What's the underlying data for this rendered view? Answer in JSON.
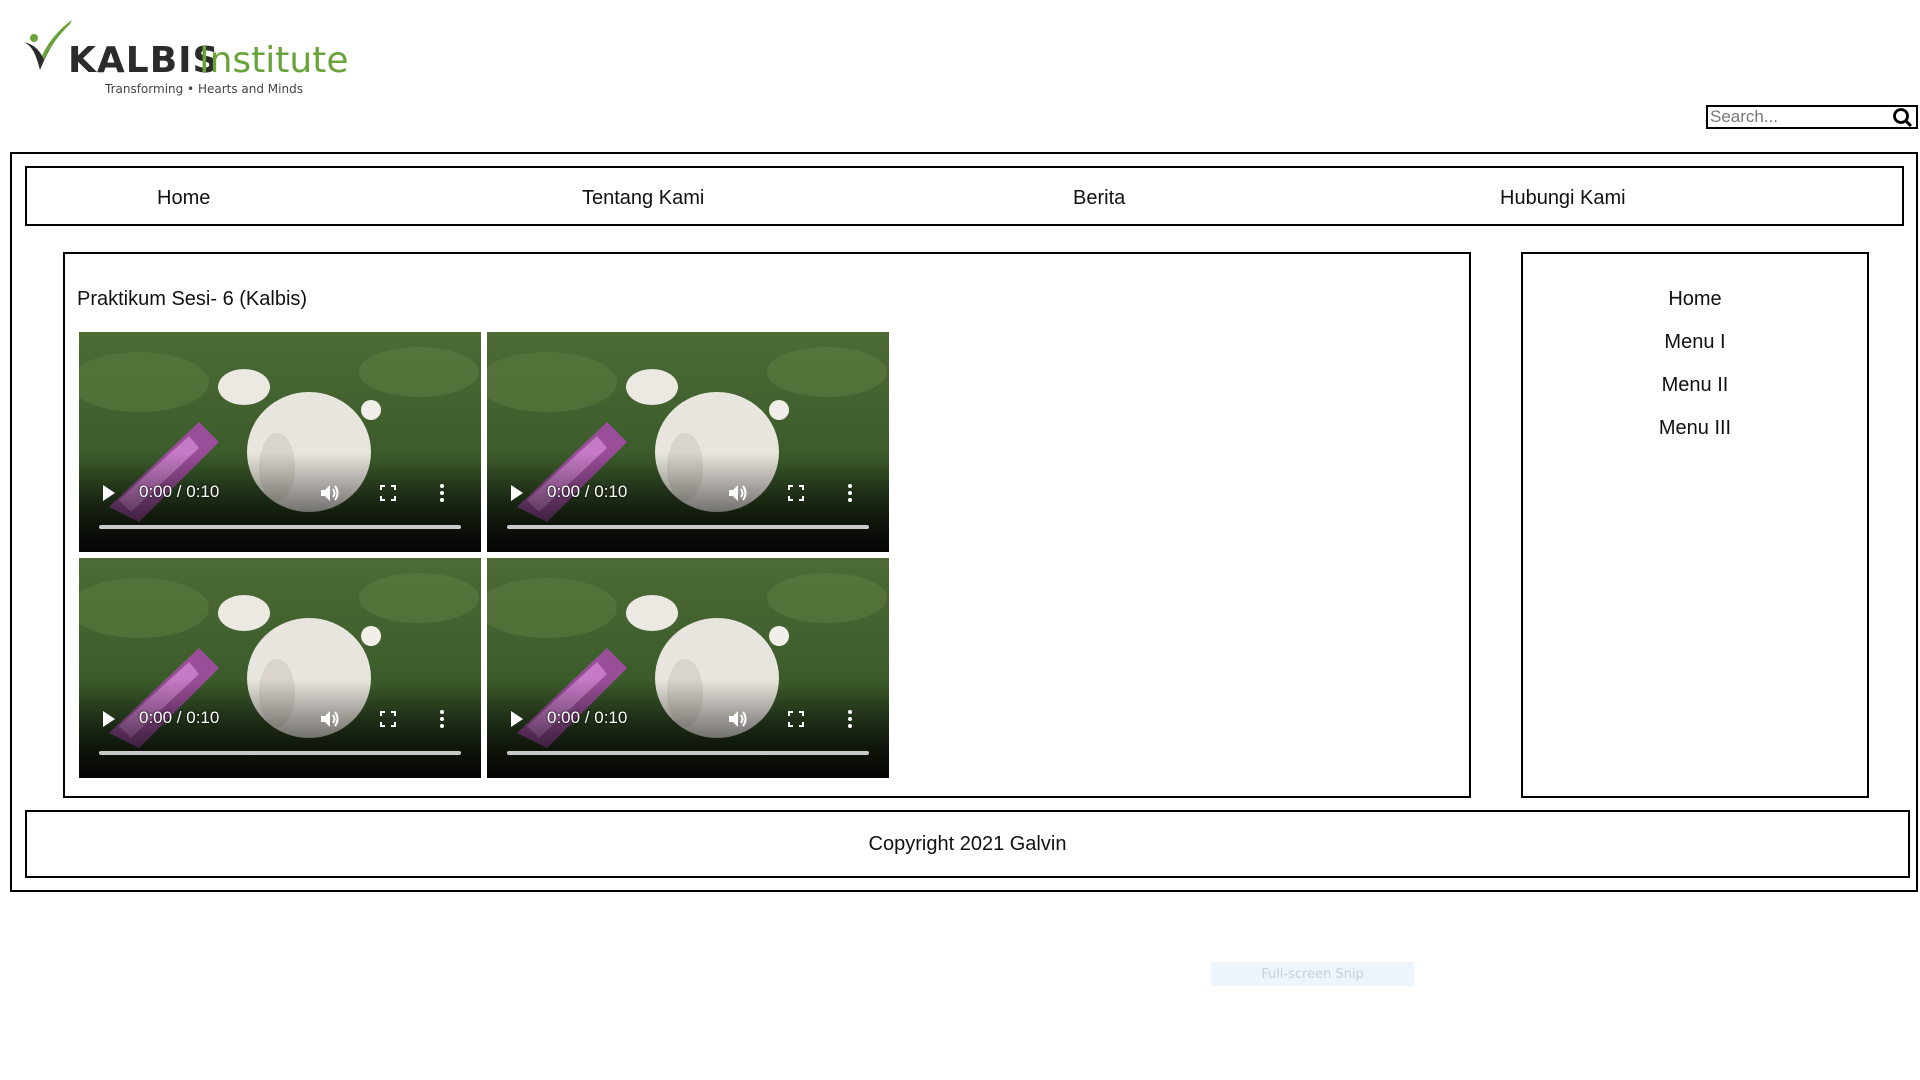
{
  "logo": {
    "brand": "KALBIS",
    "brand_suffix": "Institute",
    "tagline": "Transforming • Hearts and Minds"
  },
  "search": {
    "placeholder": "Search..."
  },
  "nav": {
    "items": [
      {
        "label": "Home"
      },
      {
        "label": "Tentang Kami"
      },
      {
        "label": "Berita"
      },
      {
        "label": "Hubungi Kami"
      }
    ]
  },
  "main": {
    "title": "Praktikum Sesi- 6 (Kalbis)",
    "videos": [
      {
        "time": "0:00 / 0:10"
      },
      {
        "time": "0:00 / 0:10"
      },
      {
        "time": "0:00 / 0:10"
      },
      {
        "time": "0:00 / 0:10"
      }
    ]
  },
  "sidebar": {
    "items": [
      {
        "label": "Home"
      },
      {
        "label": "Menu I"
      },
      {
        "label": "Menu II"
      },
      {
        "label": "Menu III"
      }
    ]
  },
  "footer": {
    "text": "Copyright 2021 Galvin"
  },
  "overlay": {
    "snip_label": "Full-screen Snip"
  },
  "colors": {
    "brand_green": "#6aa339",
    "border": "#000000",
    "brand_dark": "#2b2b2b"
  }
}
